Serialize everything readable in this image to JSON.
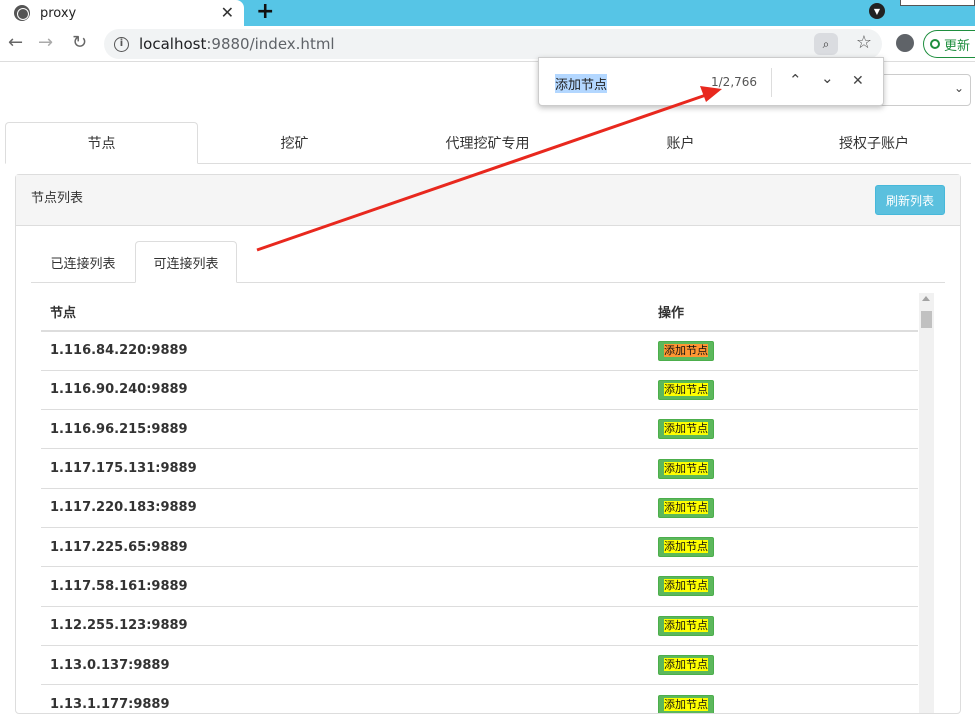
{
  "browser": {
    "tab_title": "proxy",
    "tab_close": "✕",
    "new_tab": "+",
    "url_host": "localhost",
    "url_rest": ":9880/index.html",
    "update_label": "更新"
  },
  "find_bar": {
    "query": "添加节点",
    "count": "1/2,766",
    "prev": "⌃",
    "next": "⌄",
    "close": "✕"
  },
  "nav_tabs": [
    "节点",
    "挖矿",
    "代理挖矿专用",
    "账户",
    "授权子账户"
  ],
  "panel": {
    "title": "节点列表",
    "refresh_label": "刷新列表",
    "sub_tabs": [
      "已连接列表",
      "可连接列表"
    ],
    "table": {
      "headers": [
        "节点",
        "操作"
      ],
      "action_label": "添加节点",
      "rows": [
        "1.116.84.220:9889",
        "1.116.90.240:9889",
        "1.116.96.215:9889",
        "1.117.175.131:9889",
        "1.117.220.183:9889",
        "1.117.225.65:9889",
        "1.117.58.161:9889",
        "1.12.255.123:9889",
        "1.13.0.137:9889",
        "1.13.1.177:9889"
      ]
    }
  },
  "colors": {
    "tabstrip": "#56c5e6",
    "info_button": "#5bc0de",
    "success_button": "#5cb85c",
    "find_highlight": "#ffff00",
    "current_match": "#ff9632",
    "annotation_arrow": "#e8281e"
  }
}
